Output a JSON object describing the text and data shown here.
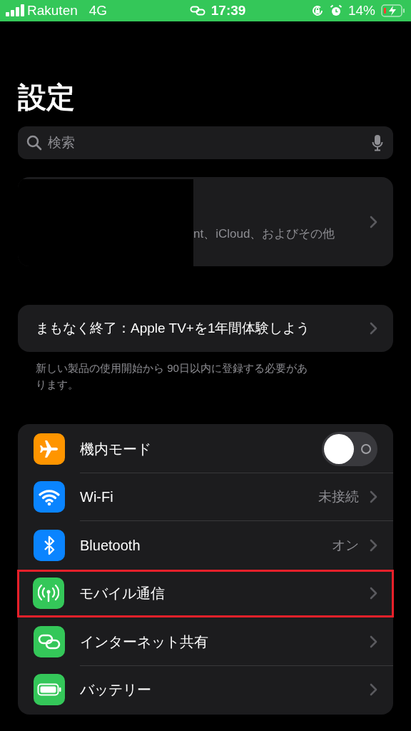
{
  "status_bar": {
    "carrier": "Rakuten",
    "network": "4G",
    "time": "17:39",
    "battery": "14%"
  },
  "title": "設定",
  "search": {
    "placeholder": "検索"
  },
  "account_card": {
    "subtitle": "nt、iCloud、およびその他"
  },
  "promo": {
    "label": "まもなく終了：Apple TV+を1年間体験しよう",
    "note": "新しい製品の使用開始から 90日以内に登録する必要があります。"
  },
  "settings": [
    {
      "label": "機内モード",
      "kind": "toggle",
      "on": false,
      "color": "#ff9500",
      "highlighted": false
    },
    {
      "label": "Wi-Fi",
      "kind": "link",
      "value": "未接続",
      "color": "#0a84ff",
      "highlighted": false
    },
    {
      "label": "Bluetooth",
      "kind": "link",
      "value": "オン",
      "color": "#0a84ff",
      "highlighted": false
    },
    {
      "label": "モバイル通信",
      "kind": "link",
      "color": "#34c759",
      "highlighted": true
    },
    {
      "label": "インターネット共有",
      "kind": "link",
      "color": "#34c759",
      "highlighted": false
    },
    {
      "label": "バッテリー",
      "kind": "link",
      "color": "#34c759",
      "highlighted": false
    }
  ]
}
